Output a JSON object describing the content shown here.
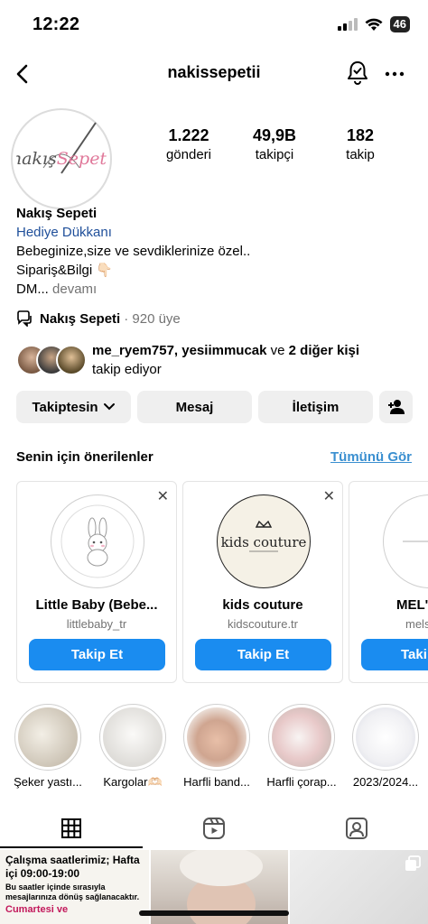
{
  "status_bar": {
    "time": "12:22",
    "battery": "46"
  },
  "nav": {
    "username": "nakissepetii"
  },
  "profile": {
    "logo_text_left": "nakış",
    "logo_text_pink": "Sepeti",
    "stats": [
      {
        "value": "1.222",
        "label": "gönderi"
      },
      {
        "value": "49,9B",
        "label": "takipçi"
      },
      {
        "value": "182",
        "label": "takip"
      }
    ],
    "name": "Nakış Sepeti",
    "category": "Hediye Dükkanı",
    "bio_line1": "Bebeginize,size ve sevdiklerinize özel..",
    "bio_line2": "Sipariş&Bilgi 👇🏻",
    "bio_line3": "DM...",
    "bio_more": "devamı",
    "community_name": "Nakış Sepeti",
    "community_members": "· 920 üye",
    "followed_by_names": "me_ryem757, yesiimmucak",
    "followed_by_and": "ve",
    "followed_by_others": "2 diğer kişi",
    "followed_by_suffix": "takip ediyor"
  },
  "actions": {
    "following": "Takiptesin",
    "message": "Mesaj",
    "contact": "İletişim"
  },
  "suggestions": {
    "title": "Senin için önerilenler",
    "see_all": "Tümünü Gör",
    "cards": [
      {
        "name": "Little Baby  (Bebe...",
        "handle": "littlebaby_tr",
        "follow": "Takip Et"
      },
      {
        "name": "kids couture",
        "handle": "kidscouture.tr",
        "follow": "Takip Et"
      },
      {
        "name": "MEL'S I",
        "handle": "mels.d",
        "follow": "Taki"
      }
    ]
  },
  "highlights": [
    {
      "label": "Şeker yastı..."
    },
    {
      "label": "Kargolar🫶🏻"
    },
    {
      "label": "Harfli band..."
    },
    {
      "label": "Harfli çorap..."
    },
    {
      "label": "2023/2024..."
    }
  ],
  "grid": {
    "post1_line1": "Çalışma saatlerimiz; Hafta içi 09:00-19:00",
    "post1_line2": "Bu saatler içinde sırasıyla mesajlarınıza dönüş sağlanacaktır.",
    "post1_line3": "Cumartesi ve"
  }
}
